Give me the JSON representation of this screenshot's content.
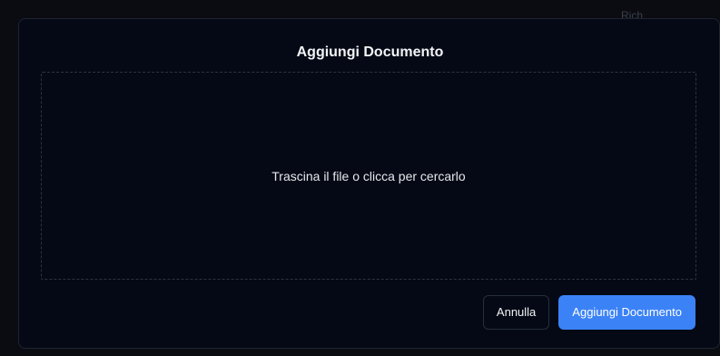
{
  "background": {
    "partial_text": "Rich"
  },
  "modal": {
    "title": "Aggiungi Documento",
    "dropzone_text": "Trascina il file o clicca per cercarlo",
    "cancel_label": "Annulla",
    "submit_label": "Aggiungi Documento"
  },
  "colors": {
    "modal_background": "#050915",
    "primary_button": "#3b82f6",
    "dropzone_border": "#2c3342"
  }
}
